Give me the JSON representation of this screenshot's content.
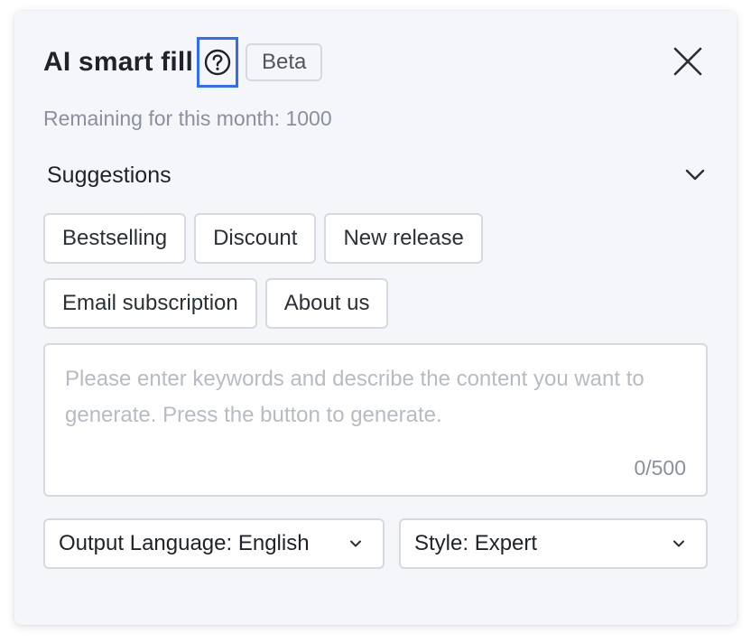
{
  "header": {
    "title": "AI smart fill",
    "beta_label": "Beta",
    "help_icon": "question-circle-icon",
    "close_icon": "close-icon"
  },
  "remaining_text": "Remaining for this month: 1000",
  "suggestions": {
    "title": "Suggestions",
    "toggle_icon": "chevron-down-icon",
    "chips": [
      "Bestselling",
      "Discount",
      "New release",
      "Email subscription",
      "About us"
    ]
  },
  "prompt_input": {
    "placeholder": "Please enter keywords and describe the content you want to generate. Press the button to generate.",
    "value": "",
    "counter": "0/500"
  },
  "output_language": {
    "label": "Output Language: English"
  },
  "style": {
    "label": "Style: Expert"
  },
  "colors": {
    "panel_background": "#f5f6fa",
    "focus_outline": "#2f6bff",
    "border": "#d6d9e0",
    "text_primary": "#1f2329",
    "text_secondary": "#8a909c",
    "placeholder": "#b7bbc4"
  }
}
